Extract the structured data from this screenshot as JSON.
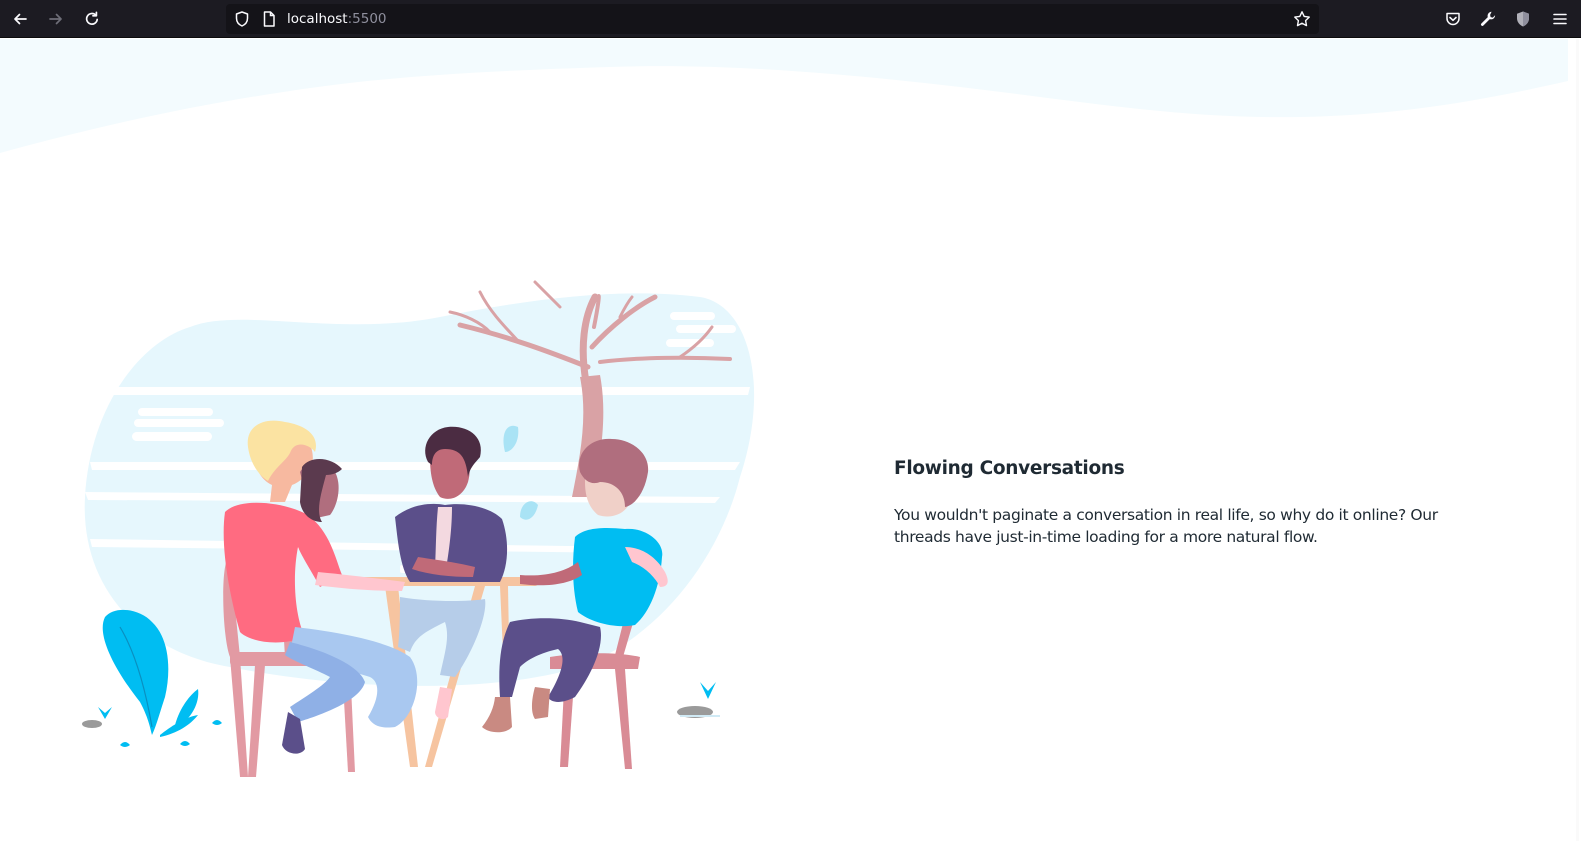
{
  "browser": {
    "url_host": "localhost",
    "url_port": ":5500"
  },
  "feature": {
    "title": "Flowing Conversations",
    "description": "You wouldn't paginate a conversation in real life, so why do it online? Our threads have just-in-time loading for a more natural flow."
  },
  "colors": {
    "chrome_bg": "#1c1b22",
    "urlbar_bg": "#141318",
    "wave": "#f3fbfe",
    "sky": "#e6f7fd",
    "accent_cyan": "#00bdf2",
    "tree": "#d9a2a5",
    "table": "#f6c4a0",
    "text": "#1f2a33"
  },
  "icons": {
    "back": "back-arrow-icon",
    "forward": "forward-arrow-icon",
    "reload": "reload-icon",
    "shield": "tracking-protection-shield-icon",
    "page": "page-info-icon",
    "bookmark": "bookmark-star-icon",
    "pocket": "pocket-icon",
    "devtools": "wrench-icon",
    "extension": "extension-shield-icon",
    "menu": "hamburger-menu-icon"
  }
}
